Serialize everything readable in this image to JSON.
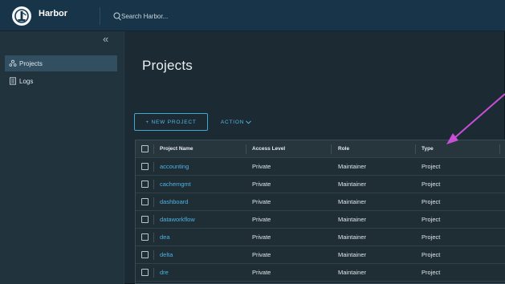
{
  "header": {
    "app_title": "Harbor",
    "search_placeholder": "Search Harbor..."
  },
  "sidebar": {
    "collapse_glyph": "«",
    "items": [
      {
        "label": "Projects",
        "icon": "projects-icon",
        "active": true
      },
      {
        "label": "Logs",
        "icon": "logs-icon",
        "active": false
      }
    ]
  },
  "main": {
    "title": "Projects",
    "new_project_label": "+ NEW PROJECT",
    "action_label": "ACTION"
  },
  "table": {
    "columns": [
      "Project Name",
      "Access Level",
      "Role",
      "Type"
    ],
    "rows": [
      {
        "name": "accounting",
        "access": "Private",
        "role": "Maintainer",
        "type": "Project"
      },
      {
        "name": "cachemgmt",
        "access": "Private",
        "role": "Maintainer",
        "type": "Project"
      },
      {
        "name": "dashboard",
        "access": "Private",
        "role": "Maintainer",
        "type": "Project"
      },
      {
        "name": "dataworkflow",
        "access": "Private",
        "role": "Maintainer",
        "type": "Project"
      },
      {
        "name": "dea",
        "access": "Private",
        "role": "Maintainer",
        "type": "Project"
      },
      {
        "name": "delta",
        "access": "Private",
        "role": "Maintainer",
        "type": "Project"
      },
      {
        "name": "dre",
        "access": "Private",
        "role": "Maintainer",
        "type": "Project"
      }
    ]
  },
  "colors": {
    "header_bg": "#173448",
    "sidebar_bg": "#21333c",
    "content_bg": "#1b2a33",
    "accent": "#4fb1e0",
    "annotation_arrow": "#c94fd6"
  }
}
